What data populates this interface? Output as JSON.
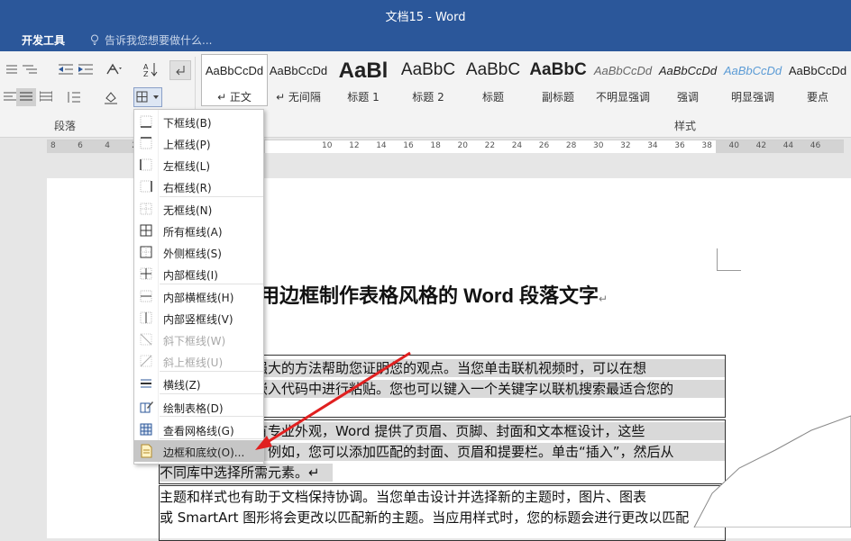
{
  "window": {
    "title": "文档15 - Word"
  },
  "tabs": {
    "developer": "开发工具",
    "tell_me": "告诉我您想要做什么..."
  },
  "ribbon": {
    "paragraph_group": "段落",
    "styles_group": "样式",
    "styles": [
      {
        "sample": "AaBbCcDd",
        "name": "↵ 正文",
        "active": true
      },
      {
        "sample": "AaBbCcDd",
        "name": "↵ 无间隔"
      },
      {
        "sample": "AaBl",
        "name": "标题 1"
      },
      {
        "sample": "AaBbC",
        "name": "标题 2"
      },
      {
        "sample": "AaBbC",
        "name": "标题"
      },
      {
        "sample": "AaBbC",
        "name": "副标题"
      },
      {
        "sample": "AaBbCcDd",
        "name": "不明显强调"
      },
      {
        "sample": "AaBbCcDd",
        "name": "强调"
      },
      {
        "sample": "AaBbCcDd",
        "name": "明显强调"
      },
      {
        "sample": "AaBbCcDd",
        "name": "要点"
      }
    ]
  },
  "ruler": {
    "ticks": [
      "8",
      "6",
      "4",
      "2",
      "",
      "",
      "",
      "",
      "",
      "",
      "10",
      "12",
      "14",
      "16",
      "18",
      "20",
      "22",
      "24",
      "26",
      "28",
      "30",
      "32",
      "34",
      "36",
      "38",
      "40",
      "42",
      "44",
      "46"
    ]
  },
  "border_menu": {
    "items": [
      {
        "label": "下框线(B)",
        "icon": "border-bottom-icon"
      },
      {
        "label": "上框线(P)",
        "icon": "border-top-icon"
      },
      {
        "label": "左框线(L)",
        "icon": "border-left-icon"
      },
      {
        "label": "右框线(R)",
        "icon": "border-right-icon"
      },
      {
        "label": "无框线(N)",
        "icon": "border-none-icon"
      },
      {
        "label": "所有框线(A)",
        "icon": "border-all-icon"
      },
      {
        "label": "外侧框线(S)",
        "icon": "border-outside-icon"
      },
      {
        "label": "内部框线(I)",
        "icon": "border-inside-icon"
      },
      {
        "label": "内部横框线(H)",
        "icon": "border-inside-horizontal-icon"
      },
      {
        "label": "内部竖框线(V)",
        "icon": "border-inside-vertical-icon"
      },
      {
        "label": "斜下框线(W)",
        "icon": "diagonal-down-icon",
        "disabled": true
      },
      {
        "label": "斜上框线(U)",
        "icon": "diagonal-up-icon",
        "disabled": true
      },
      {
        "label": "横线(Z)",
        "icon": "horizontal-line-icon"
      },
      {
        "label": "绘制表格(D)",
        "icon": "draw-table-icon"
      },
      {
        "label": "查看网格线(G)",
        "icon": "view-gridlines-icon"
      },
      {
        "label": "边框和底纹(O)...",
        "icon": "borders-shading-icon",
        "highlighted": true
      }
    ]
  },
  "document": {
    "title": "用边框制作表格风格的 Word 段落文字",
    "title_mark": "↵",
    "rows": [
      {
        "lines": [
          "视频提供了功能强大的方法帮助您证明您的观点。当您单击联机视频时，可以在想",
          "要添加的视频的嵌入代码中进行粘贴。您也可以键入一个关键字以联机搜索最适合您的"
        ]
      },
      {
        "lines": [
          "为使您的文档具有专业外观，Word 提供了页眉、页脚、封面和文本框设计，这些",
          "设计可互为补充。例如，您可以添加匹配的封面、页眉和提要栏。单击“插入”，然后从",
          "不同库中选择所需元素。↵"
        ]
      },
      {
        "lines": [
          "    主题和样式也有助于文档保持协调。当您单击设计并选择新的主题时，图片、图表",
          "或 SmartArt 图形将会更改以匹配新的主题。当应用样式时，您的标题会进行更改以匹配"
        ]
      }
    ]
  },
  "colors": {
    "title_bar": "#2b579a",
    "arrow": "#e02020",
    "menu_highlight": "#c6c6c6"
  }
}
